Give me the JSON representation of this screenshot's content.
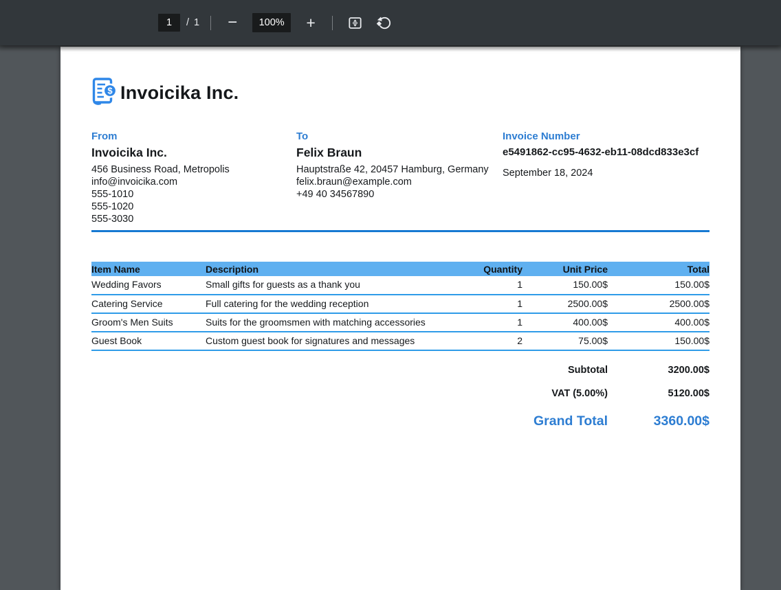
{
  "toolbar": {
    "page_current": "1",
    "page_separator": "/",
    "page_total": "1",
    "zoom_out_label": "−",
    "zoom_level": "100%",
    "zoom_in_label": "+"
  },
  "invoice": {
    "company_name": "Invoicika Inc.",
    "from": {
      "label": "From",
      "name": "Invoicika Inc.",
      "address": "456 Business Road, Metropolis",
      "email": "info@invoicika.com",
      "phones": [
        "555-1010",
        "555-1020",
        "555-3030"
      ]
    },
    "to": {
      "label": "To",
      "name": "Felix Braun",
      "address": "Hauptstraße 42, 20457 Hamburg, Germany",
      "email": "felix.braun@example.com",
      "phone": "+49 40 34567890"
    },
    "invoice_number": {
      "label": "Invoice Number",
      "value": "e5491862-cc95-4632-eb11-08dcd833e3cf",
      "date": "September 18, 2024"
    },
    "table": {
      "headers": [
        "Item Name",
        "Description",
        "Quantity",
        "Unit Price",
        "Total"
      ],
      "rows": [
        {
          "item": "Wedding Favors",
          "description": "Small gifts for guests as a thank you",
          "quantity": "1",
          "unit_price": "150.00$",
          "total": "150.00$"
        },
        {
          "item": "Catering Service",
          "description": "Full catering for the wedding reception",
          "quantity": "1",
          "unit_price": "2500.00$",
          "total": "2500.00$"
        },
        {
          "item": "Groom's Men Suits",
          "description": "Suits for the groomsmen with matching accessories",
          "quantity": "1",
          "unit_price": "400.00$",
          "total": "400.00$"
        },
        {
          "item": "Guest Book",
          "description": "Custom guest book for signatures and messages",
          "quantity": "2",
          "unit_price": "75.00$",
          "total": "150.00$"
        }
      ]
    },
    "totals": {
      "subtotal_label": "Subtotal",
      "subtotal_value": "3200.00$",
      "vat_label": "VAT (5.00%)",
      "vat_value": "5120.00$",
      "grand_total_label": "Grand Total",
      "grand_total_value": "3360.00$"
    }
  },
  "colors": {
    "accent_blue": "#2d7dd2",
    "table_header_blue": "#5fb0f0",
    "row_divider_blue": "#2e9be8",
    "section_rule_blue": "#1679d2",
    "logo_blue": "#2f87e8",
    "toolbar_bg": "#32373b",
    "viewer_bg": "#51565a"
  }
}
